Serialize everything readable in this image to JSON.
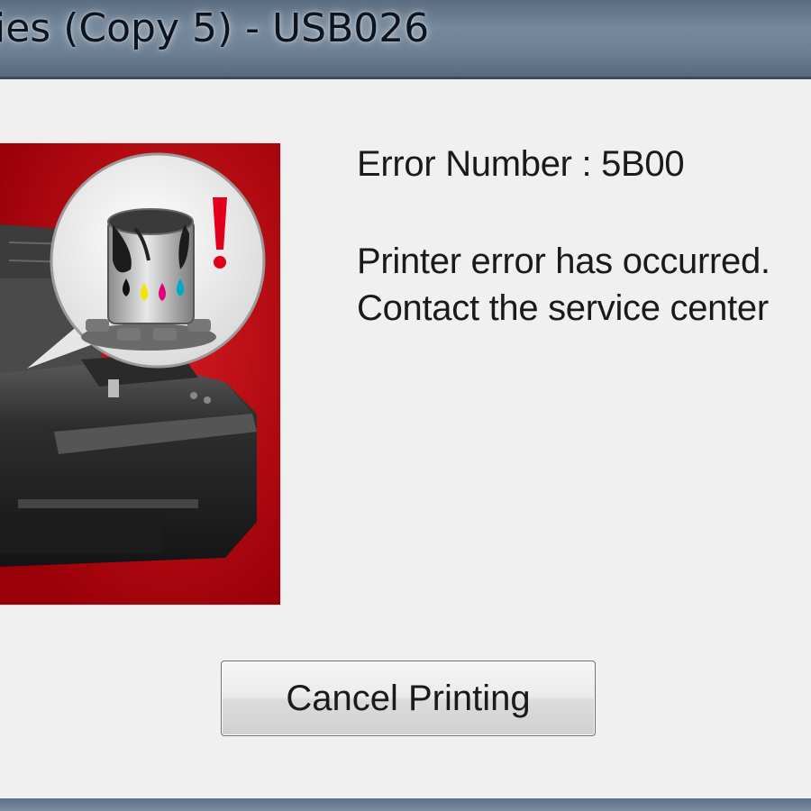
{
  "window": {
    "title": "ies (Copy 5) - USB026"
  },
  "dialog": {
    "error_number": "Error Number : 5B00",
    "message_line1": "Printer error has occurred.",
    "message_line2": "Contact the service center",
    "cancel_button_label": "Cancel Printing"
  },
  "illustration": {
    "icon": "printer-ink-absorber-error-icon",
    "background_color": "#b3000c",
    "alert_color": "#e3001b",
    "ink_colors": [
      "#111111",
      "#f2e600",
      "#e0007a",
      "#e0007a",
      "#00a8c8"
    ]
  }
}
